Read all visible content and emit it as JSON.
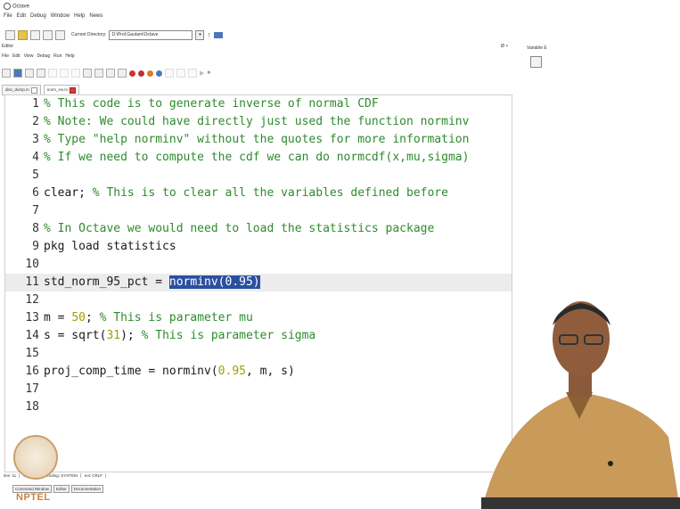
{
  "app": {
    "title": "Octave"
  },
  "menubar": {
    "items": [
      "File",
      "Edit",
      "Debug",
      "Window",
      "Help",
      "News"
    ]
  },
  "toolbar": {
    "current_directory_label": "Current Directory:",
    "current_directory_value": "D:\\Prof.Gautam\\Octave"
  },
  "editor_pane": {
    "title": "Editor",
    "right_controls": "Ø ×",
    "menu": [
      "File",
      "Edit",
      "View",
      "Debug",
      "Run",
      "Help"
    ]
  },
  "right_pane": {
    "title": "Variable E"
  },
  "tabs": [
    {
      "label": "disc_dump.m",
      "active": false
    },
    {
      "label": "norm_inv.m",
      "active": true
    }
  ],
  "code_lines": [
    {
      "n": "1",
      "code": "% This code is to generate inverse of normal CDF"
    },
    {
      "n": "2",
      "code": "% Note: We could have directly just used the function norminv"
    },
    {
      "n": "3",
      "code": "% Type \"help norminv\" without the quotes for more information"
    },
    {
      "n": "4",
      "code": "% If we need to compute the cdf we can do normcdf(x,mu,sigma)"
    },
    {
      "n": "5",
      "code": ""
    },
    {
      "n": "6",
      "code": "clear; % This is to clear all the variables defined before"
    },
    {
      "n": "7",
      "code": ""
    },
    {
      "n": "8",
      "code": "% In Octave we would need to load the statistics package"
    },
    {
      "n": "9",
      "code": "pkg load statistics"
    },
    {
      "n": "10",
      "code": ""
    },
    {
      "n": "11",
      "code": "std_norm_95_pct = norminv(0.95)"
    },
    {
      "n": "12",
      "code": ""
    },
    {
      "n": "13",
      "code": "m = 50; % This is parameter mu"
    },
    {
      "n": "14",
      "code": "s = sqrt(31); % This is parameter sigma"
    },
    {
      "n": "15",
      "code": ""
    },
    {
      "n": "16",
      "code": "proj_comp_time = norminv(0.95, m, s)"
    },
    {
      "n": "17",
      "code": ""
    },
    {
      "n": "18",
      "code": ""
    }
  ],
  "current_line": "11",
  "selected_text": "norminv(0.95)",
  "status_bar": {
    "line": "line: 11",
    "col": "col: 31",
    "encoding": "encoding: SYSTEM",
    "eol": "eol: CRLF"
  },
  "bottom_tabs": [
    "Command Window",
    "Editor",
    "Documentation"
  ],
  "watermark": {
    "text": "NPTEL"
  },
  "colors": {
    "comment": "#2e8b2e",
    "number": "#a0a000",
    "selection": "#2b4fa0",
    "current_line": "#ececec"
  }
}
